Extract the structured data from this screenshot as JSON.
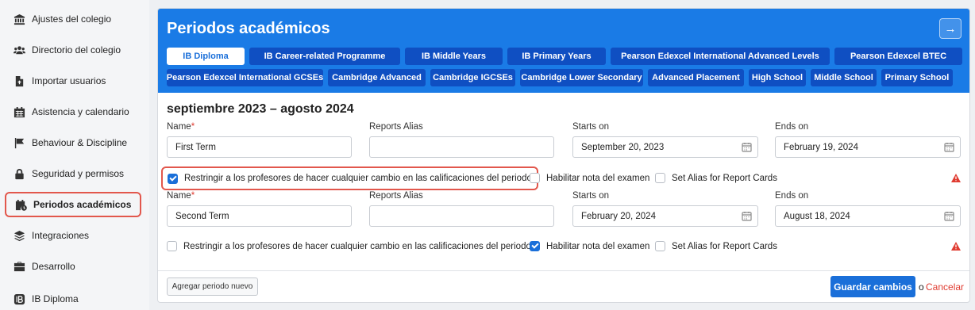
{
  "sidebar": {
    "items": [
      {
        "label": "Ajustes del colegio",
        "icon": "bank-icon"
      },
      {
        "label": "Directorio del colegio",
        "icon": "users-icon"
      },
      {
        "label": "Importar usuarios",
        "icon": "file-import-icon"
      },
      {
        "label": "Asistencia y calendario",
        "icon": "calendar-icon"
      },
      {
        "label": "Behaviour & Discipline",
        "icon": "flag-icon"
      },
      {
        "label": "Seguridad y permisos",
        "icon": "lock-icon"
      },
      {
        "label": "Periodos académicos",
        "icon": "calendar-clock-icon",
        "active": true
      },
      {
        "label": "Integraciones",
        "icon": "layers-icon"
      },
      {
        "label": "Desarrollo",
        "icon": "briefcase-icon"
      },
      {
        "label": "IB Diploma",
        "icon": "ib-icon"
      }
    ]
  },
  "panel": {
    "title": "Periodos académicos",
    "arrow_glyph": "→",
    "tabs_row1": [
      "IB Diploma",
      "IB Career-related Programme",
      "IB Middle Years",
      "IB Primary Years",
      "Pearson Edexcel International Advanced Levels",
      "Pearson Edexcel BTEC"
    ],
    "tabs_row2": [
      "Pearson Edexcel International GCSEs",
      "Cambridge Advanced",
      "Cambridge IGCSEs",
      "Cambridge Lower Secondary",
      "Advanced Placement",
      "High School",
      "Middle School",
      "Primary School"
    ],
    "active_tab": "IB Diploma",
    "year_title": "septiembre 2023 – agosto 2024"
  },
  "labels": {
    "name": "Name",
    "required_mark": "*",
    "alias": "Reports Alias",
    "starts": "Starts on",
    "ends": "Ends on",
    "restrict": "Restringir a los profesores de hacer cualquier cambio en las calificaciones del periodo",
    "exam": "Habilitar nota del examen",
    "set_alias": "Set Alias for Report Cards"
  },
  "periods": [
    {
      "name": "First Term",
      "alias": "",
      "starts": "September 20, 2023",
      "ends": "February 19, 2024",
      "restrict": true,
      "exam": false,
      "set_alias": false
    },
    {
      "name": "Second Term",
      "alias": "",
      "starts": "February 20, 2024",
      "ends": "August 18, 2024",
      "restrict": false,
      "exam": true,
      "set_alias": false
    }
  ],
  "footer": {
    "add_label": "Agregar periodo nuevo",
    "save_label": "Guardar cambios",
    "or_label": "o",
    "cancel_label": "Cancelar"
  },
  "colors": {
    "header_blue": "#1a7be6",
    "tab_dark": "#0f4fc2",
    "highlight_red": "#e2574c",
    "cancel_red": "#e03c31",
    "warning_red": "#e03c31"
  }
}
